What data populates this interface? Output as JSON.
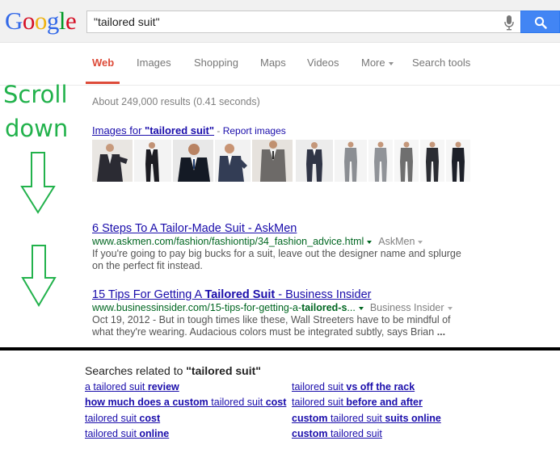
{
  "logo": {
    "letters": [
      "G",
      "o",
      "o",
      "g",
      "l",
      "e"
    ],
    "colors": [
      "#3369e8",
      "#d50f25",
      "#eeb211",
      "#3369e8",
      "#009925",
      "#d50f25"
    ]
  },
  "search": {
    "query": "\"tailored suit\""
  },
  "tabs": [
    "Web",
    "Images",
    "Shopping",
    "Maps",
    "Videos",
    "More",
    "Search tools"
  ],
  "stats": "About 249,000 results (0.41 seconds)",
  "annotation": {
    "line1": "Scroll",
    "line2": "down",
    "color": "#22b24c"
  },
  "images_block": {
    "title_prefix": "Images for ",
    "title_query": "\"tailored suit\"",
    "report": "Report images",
    "separator": " - "
  },
  "results": [
    {
      "title": "6 Steps To A Tailor-Made Suit - AskMen",
      "url": "www.askmen.com/fashion/fashiontip/34_fashion_advice.html",
      "source": "AskMen",
      "snippet_1": "If you're going to pay big bucks for a suit, leave out the designer name and splurge",
      "snippet_2": "on the perfect fit instead."
    },
    {
      "title_a": "15 Tips For Getting A ",
      "title_b": "Tailored Suit",
      "title_c": " - Business Insider",
      "url_a": "www.businessinsider.com/15-tips-for-getting-a-",
      "url_b": "tailored-s",
      "url_c": "...",
      "source": "Business Insider",
      "snippet_1": "Oct 19, 2012 - But in tough times like these, Wall Streeters have to be mindful of",
      "snippet_2": "what they're wearing. Audacious colors must be integrated subtly, says Brian ",
      "snippet_2_ellipsis": "..."
    }
  ],
  "related": {
    "heading_prefix": "Searches related to ",
    "heading_query": "\"tailored suit\"",
    "left": [
      {
        "a": "a tailored suit ",
        "b": "review"
      },
      {
        "a": "how much does a custom ",
        "b": "tailored suit ",
        "c": "cost"
      },
      {
        "a": "tailored suit ",
        "b": "cost"
      },
      {
        "a": "tailored suit ",
        "b": "online"
      }
    ],
    "right": [
      {
        "a": "tailored suit ",
        "b": "vs off the rack"
      },
      {
        "a": "tailored suit ",
        "b": "before and after"
      },
      {
        "a": "custom ",
        "b": "tailored suit ",
        "c": "suits online"
      },
      {
        "a": "custom ",
        "b": "tailored suit"
      }
    ]
  }
}
